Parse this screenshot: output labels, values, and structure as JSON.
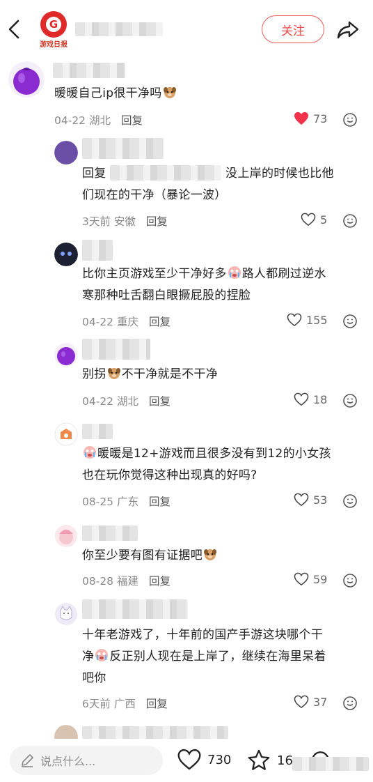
{
  "header": {
    "logo_letter": "G",
    "logo_caption": "游戏日报",
    "follow_label": "关注"
  },
  "comments": [
    {
      "text": "暖暖自己ip很干净吗",
      "date": "04-22",
      "location": "湖北",
      "reply": "回复",
      "likes": "73",
      "liked": true
    },
    {
      "text_prefix": "回复",
      "text_suffix": "没上岸的时候也比他",
      "text_line2": "们现在的干净（暴论一波）",
      "date": "3天前",
      "location": "安徽",
      "reply": "回复",
      "likes": "5"
    },
    {
      "text_line1_a": "比你主页游戏至少干净好多",
      "text_line1_b": "路人都刷过逆水",
      "text_line2": "寒那种吐舌翻白眼撅屁股的捏脸",
      "date": "04-22",
      "location": "重庆",
      "reply": "回复",
      "likes": "155"
    },
    {
      "text_a": "别拐",
      "text_b": "不干净就是不干净",
      "date": "04-22",
      "location": "湖北",
      "reply": "回复",
      "likes": "18"
    },
    {
      "text_line1": "暖暖是12+游戏而且很多没有到12的小女孩",
      "text_line2": "也在玩你觉得这种出现真的好吗?",
      "date": "08-25",
      "location": "广东",
      "reply": "回复",
      "likes": "53"
    },
    {
      "text": "你至少要有图有证据吧",
      "date": "08-28",
      "location": "福建",
      "reply": "回复",
      "likes": "59"
    },
    {
      "text_line1": "十年老游戏了，十年前的国产手游这块哪个干",
      "text_line2_a": "净",
      "text_line2_b": "反正别人现在是上岸了，继续在海里呆着",
      "text_line3": "吧你",
      "date": "6天前",
      "location": "广西",
      "reply": "回复",
      "likes": "37"
    }
  ],
  "bottom": {
    "input_placeholder": "说点什么...",
    "likes": "730",
    "stars": "16"
  },
  "icons": [
    "back-icon",
    "share-icon",
    "heart-icon",
    "more-icon",
    "pencil-icon",
    "star-icon",
    "comment-icon",
    "dog-emoji-icon",
    "crying-emoji-icon"
  ],
  "colors": {
    "accent": "#f04848",
    "liked_heart": "#f0334a",
    "meta_gray": "#8a8a8a"
  }
}
